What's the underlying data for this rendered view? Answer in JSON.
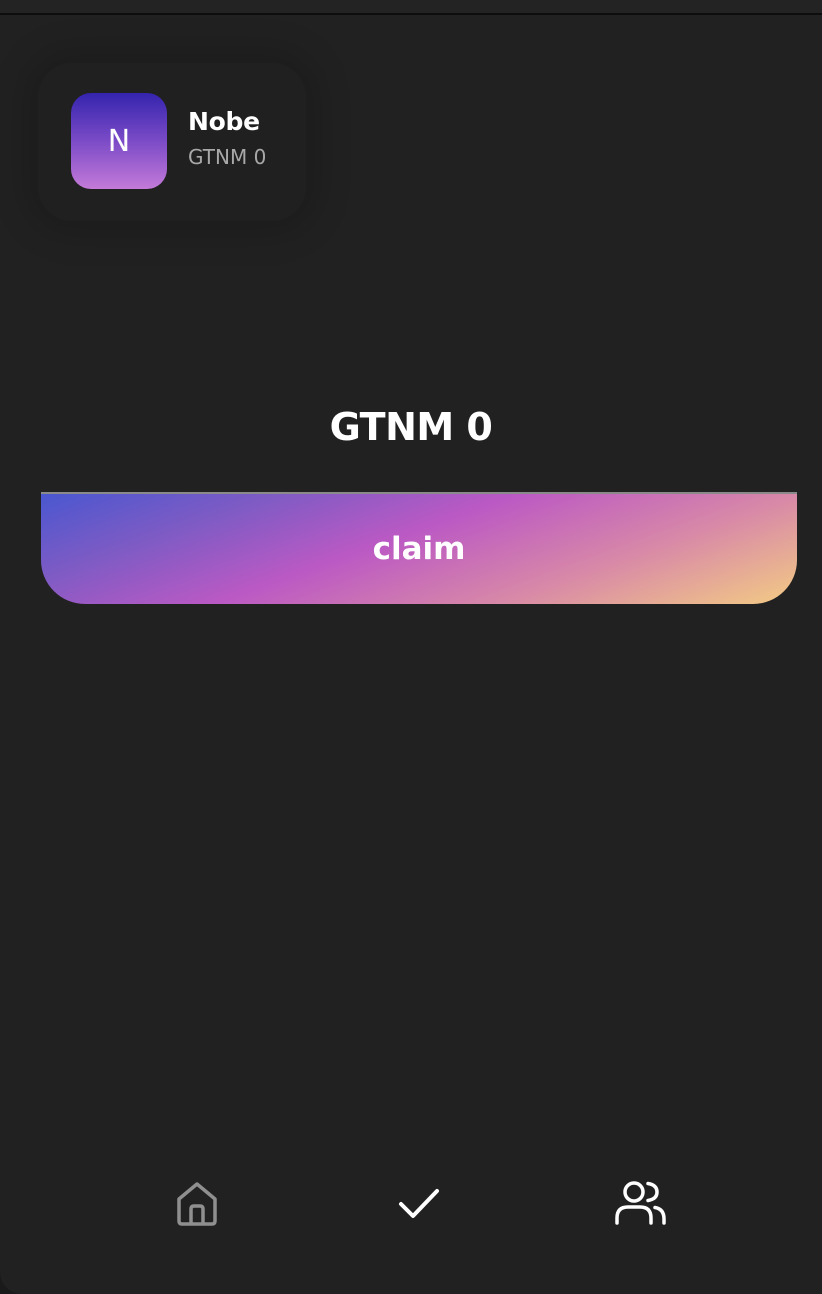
{
  "profile": {
    "avatar_initial": "N",
    "name": "Nobe",
    "balance": "GTNM 0"
  },
  "main": {
    "balance_heading": "GTNM 0",
    "claim_label": "claim"
  },
  "bottom_nav": {
    "items": [
      {
        "icon": "home-icon",
        "active": false
      },
      {
        "icon": "check-icon",
        "active": true
      },
      {
        "icon": "users-icon",
        "active": true
      }
    ]
  },
  "colors": {
    "background": "#212121",
    "text_primary": "#ffffff",
    "text_secondary": "#a8a8a8",
    "inactive_icon": "#8f8f8f",
    "gradient_start": "#4a57d0",
    "gradient_mid": "#bb59c4",
    "gradient_end": "#f3cb84"
  }
}
